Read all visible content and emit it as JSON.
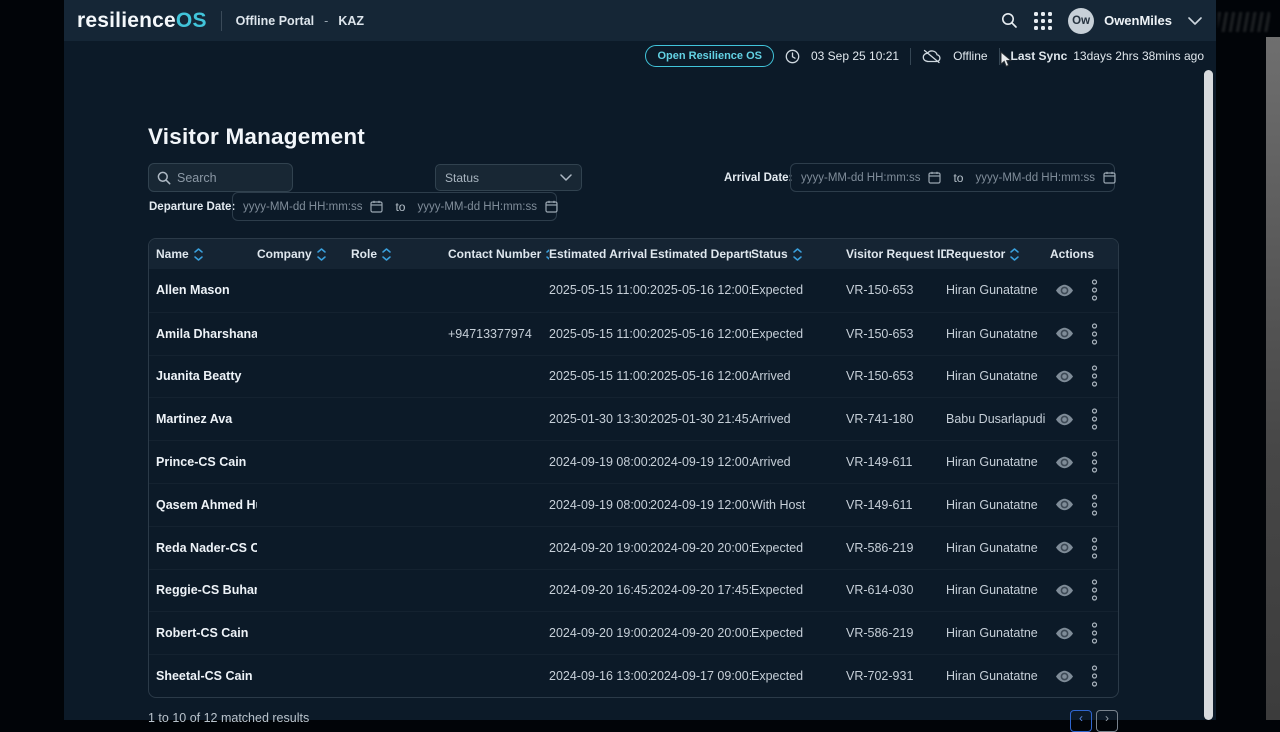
{
  "brand": {
    "prefix": "resilience",
    "suffix": "OS",
    "accent_color": "#41c4da"
  },
  "topnav": {
    "portal_label": "Offline Portal",
    "separator": "-",
    "site_code": "KAZ",
    "user": {
      "initials": "Ow",
      "name": "OwenMiles"
    },
    "icons": [
      "search-icon",
      "app-grid-icon",
      "chevron-down-icon"
    ]
  },
  "statusbar": {
    "open_button_label": "Open Resilience OS",
    "datetime": "03 Sep 25 10:21",
    "connection_status": "Offline",
    "last_sync_label": "Last Sync",
    "last_sync_value": "13days 2hrs 38mins ago"
  },
  "page": {
    "title": "Visitor Management"
  },
  "filters": {
    "search_placeholder": "Search",
    "search_value": "",
    "status_placeholder": "Status",
    "arrival_label": "Arrival Date:",
    "departure_label": "Departure Date:",
    "date_placeholder": "yyyy-MM-dd HH:mm:ss",
    "range_separator": "to"
  },
  "table": {
    "columns": [
      {
        "label": "Name",
        "sortable": true
      },
      {
        "label": "Company",
        "sortable": true
      },
      {
        "label": "Role",
        "sortable": true
      },
      {
        "label": "Contact Number",
        "sortable": true
      },
      {
        "label": "Estimated Arrival Date",
        "sortable": true
      },
      {
        "label": "Estimated Departure Date",
        "sortable": true
      },
      {
        "label": "Status",
        "sortable": true
      },
      {
        "label": "Visitor Request ID",
        "sortable": true
      },
      {
        "label": "Requestor",
        "sortable": true
      },
      {
        "label": "Actions",
        "sortable": false
      }
    ],
    "rows": [
      {
        "name": "Allen Mason",
        "company": "",
        "role": "",
        "contact": "",
        "arrival": "2025-05-15 11:00:00",
        "departure": "2025-05-16 12:00:00",
        "status": "Expected",
        "request_id": "VR-150-653",
        "requestor": "Hiran Gunatatne"
      },
      {
        "name": "Amila Dharshana",
        "company": "",
        "role": "",
        "contact": "+94713377974",
        "arrival": "2025-05-15 11:00:00",
        "departure": "2025-05-16 12:00:00",
        "status": "Expected",
        "request_id": "VR-150-653",
        "requestor": "Hiran Gunatatne"
      },
      {
        "name": "Juanita Beatty",
        "company": "",
        "role": "",
        "contact": "",
        "arrival": "2025-05-15 11:00:00",
        "departure": "2025-05-16 12:00:00",
        "status": "Arrived",
        "request_id": "VR-150-653",
        "requestor": "Hiran Gunatatne"
      },
      {
        "name": "Martinez Ava",
        "company": "",
        "role": "",
        "contact": "",
        "arrival": "2025-01-30 13:30:00",
        "departure": "2025-01-30 21:45:00",
        "status": "Arrived",
        "request_id": "VR-741-180",
        "requestor": "Babu Dusarlapudi"
      },
      {
        "name": "Prince-CS Cain",
        "company": "",
        "role": "",
        "contact": "",
        "arrival": "2024-09-19 08:00:00",
        "departure": "2024-09-19 12:00:00",
        "status": "Arrived",
        "request_id": "VR-149-611",
        "requestor": "Hiran Gunatatne"
      },
      {
        "name": "Qasem Ahmed Hus",
        "company": "",
        "role": "",
        "contact": "",
        "arrival": "2024-09-19 08:00:00",
        "departure": "2024-09-19 12:00:00",
        "status": "With Host",
        "request_id": "VR-149-611",
        "requestor": "Hiran Gunatatne"
      },
      {
        "name": "Reda Nader-CS Ca",
        "company": "",
        "role": "",
        "contact": "",
        "arrival": "2024-09-20 19:00:00",
        "departure": "2024-09-20 20:00:00",
        "status": "Expected",
        "request_id": "VR-586-219",
        "requestor": "Hiran Gunatatne"
      },
      {
        "name": "Reggie-CS Buhari",
        "company": "",
        "role": "",
        "contact": "",
        "arrival": "2024-09-20 16:45:00",
        "departure": "2024-09-20 17:45:00",
        "status": "Expected",
        "request_id": "VR-614-030",
        "requestor": "Hiran Gunatatne"
      },
      {
        "name": "Robert-CS Cain",
        "company": "",
        "role": "",
        "contact": "",
        "arrival": "2024-09-20 19:00:00",
        "departure": "2024-09-20 20:00:00",
        "status": "Expected",
        "request_id": "VR-586-219",
        "requestor": "Hiran Gunatatne"
      },
      {
        "name": "Sheetal-CS Cain",
        "company": "",
        "role": "",
        "contact": "",
        "arrival": "2024-09-16 13:00:00",
        "departure": "2024-09-17 09:00:00",
        "status": "Expected",
        "request_id": "VR-702-931",
        "requestor": "Hiran Gunatatne"
      }
    ]
  },
  "pagination": {
    "summary": "1 to 10 of 12 matched results",
    "prev_glyph": "‹",
    "next_glyph": "›"
  }
}
